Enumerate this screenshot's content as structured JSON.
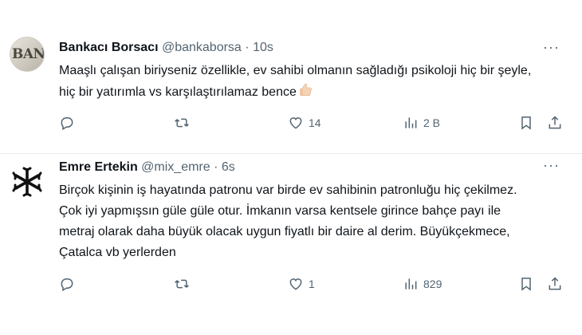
{
  "tweets": [
    {
      "display_name": "Bankacı Borsacı",
      "handle": "@bankaborsa",
      "separator": "·",
      "time": "10s",
      "avatar_icon": "bank-logo-avatar",
      "avatar_text": "BANK",
      "text": "Maaşlı çalışan biriyseniz özellikle, ev sahibi olmanın sağladığı psikoloji hiç bir şeyle, hiç bir yatırımla vs karşılaştırılamaz bence",
      "emoji_icon": "thumbs-up-icon",
      "more_label": "···",
      "actions": {
        "reply_count": "",
        "retweet_count": "",
        "like_count": "14",
        "views_count": "2 B"
      }
    },
    {
      "display_name": "Emre Ertekin",
      "handle": "@mix_emre",
      "separator": "·",
      "time": "6s",
      "avatar_icon": "asterisk-star-logo-avatar",
      "text": "Birçok kişinin iş hayatında patronu var birde ev sahibinin patronluğu hiç çekilmez. Çok iyi yapmışsın güle güle otur. İmkanın varsa kentsele girince bahçe payı ile metraj olarak daha büyük olacak uygun fiyatlı bir daire al derim. Büyükçekmece, Çatalca vb yerlerden",
      "more_label": "···",
      "actions": {
        "reply_count": "",
        "retweet_count": "",
        "like_count": "1",
        "views_count": "829"
      }
    }
  ],
  "colors": {
    "text_primary": "#0f1419",
    "text_secondary": "#536471",
    "divider": "#e6ecf0",
    "background": "#ffffff"
  }
}
